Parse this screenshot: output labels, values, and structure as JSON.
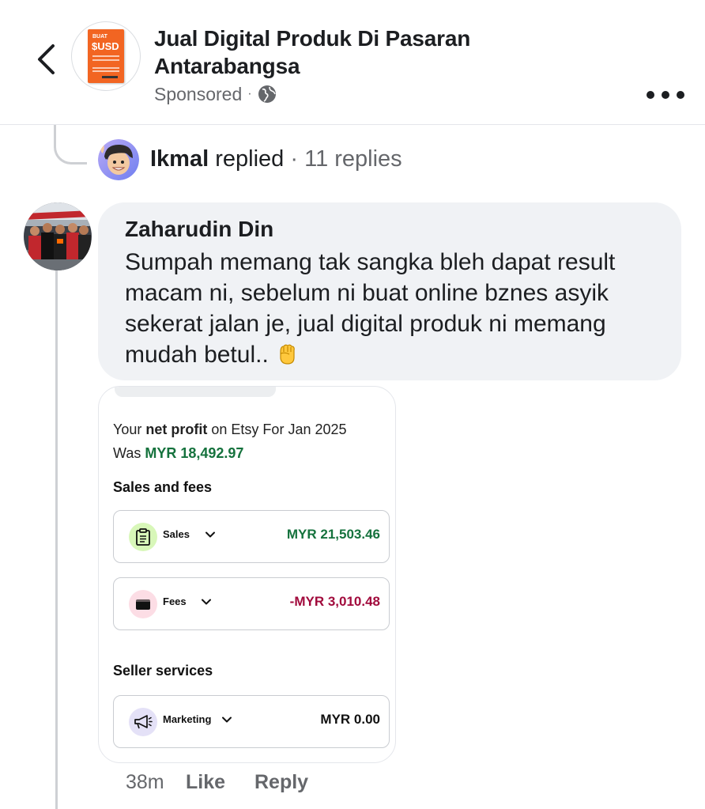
{
  "header": {
    "back_icon": "chevron-left-icon",
    "page_avatar_icon": "book-cover-icon",
    "page_avatar_text": {
      "top": "BUAT",
      "main": "$USD"
    },
    "title": "Jual Digital Produk Di Pasaran Antarabangsa",
    "sponsored": "Sponsored",
    "separator": "·",
    "audience_icon": "globe-icon",
    "more_icon": "more-horizontal-icon"
  },
  "reply_summary": {
    "name": "Ikmal",
    "action": "replied",
    "separator": "·",
    "count": "11 replies"
  },
  "comment": {
    "author": "Zaharudin Din",
    "text": "Sumpah memang tak sangka bleh dapat result macam ni, sebelum ni buat online bznes asyik sekerat jalan je, jual digital produk ni memang mudah betul..",
    "emoji_icon": "raised-fist-icon",
    "time": "38m",
    "like_label": "Like",
    "reply_label": "Reply"
  },
  "attachment": {
    "net_profit_prefix": "Your",
    "net_profit_bold": "net profit",
    "net_profit_suffix": "on Etsy For Jan 2025",
    "was_label": "Was",
    "net_profit_value": "MYR 18,492.97",
    "sales_section": "Sales and fees",
    "rows": [
      {
        "label": "Sales",
        "value": "MYR 21,503.46",
        "icon": "clipboard-icon",
        "value_color": "#15723d"
      },
      {
        "label": "Fees",
        "value": "-MYR 3,010.48",
        "icon": "wallet-icon",
        "value_color": "#a10a3c"
      }
    ],
    "seller_section": "Seller services",
    "marketing": {
      "label": "Marketing",
      "value": "MYR 0.00",
      "icon": "megaphone-icon"
    }
  },
  "colors": {
    "bubble_bg": "#f0f2f5",
    "positive": "#15723d",
    "negative": "#a10a3c",
    "sales_icon_bg": "#d8f7b9",
    "fees_icon_bg": "#fcdde5",
    "marketing_icon_bg": "#e4e1f7"
  }
}
